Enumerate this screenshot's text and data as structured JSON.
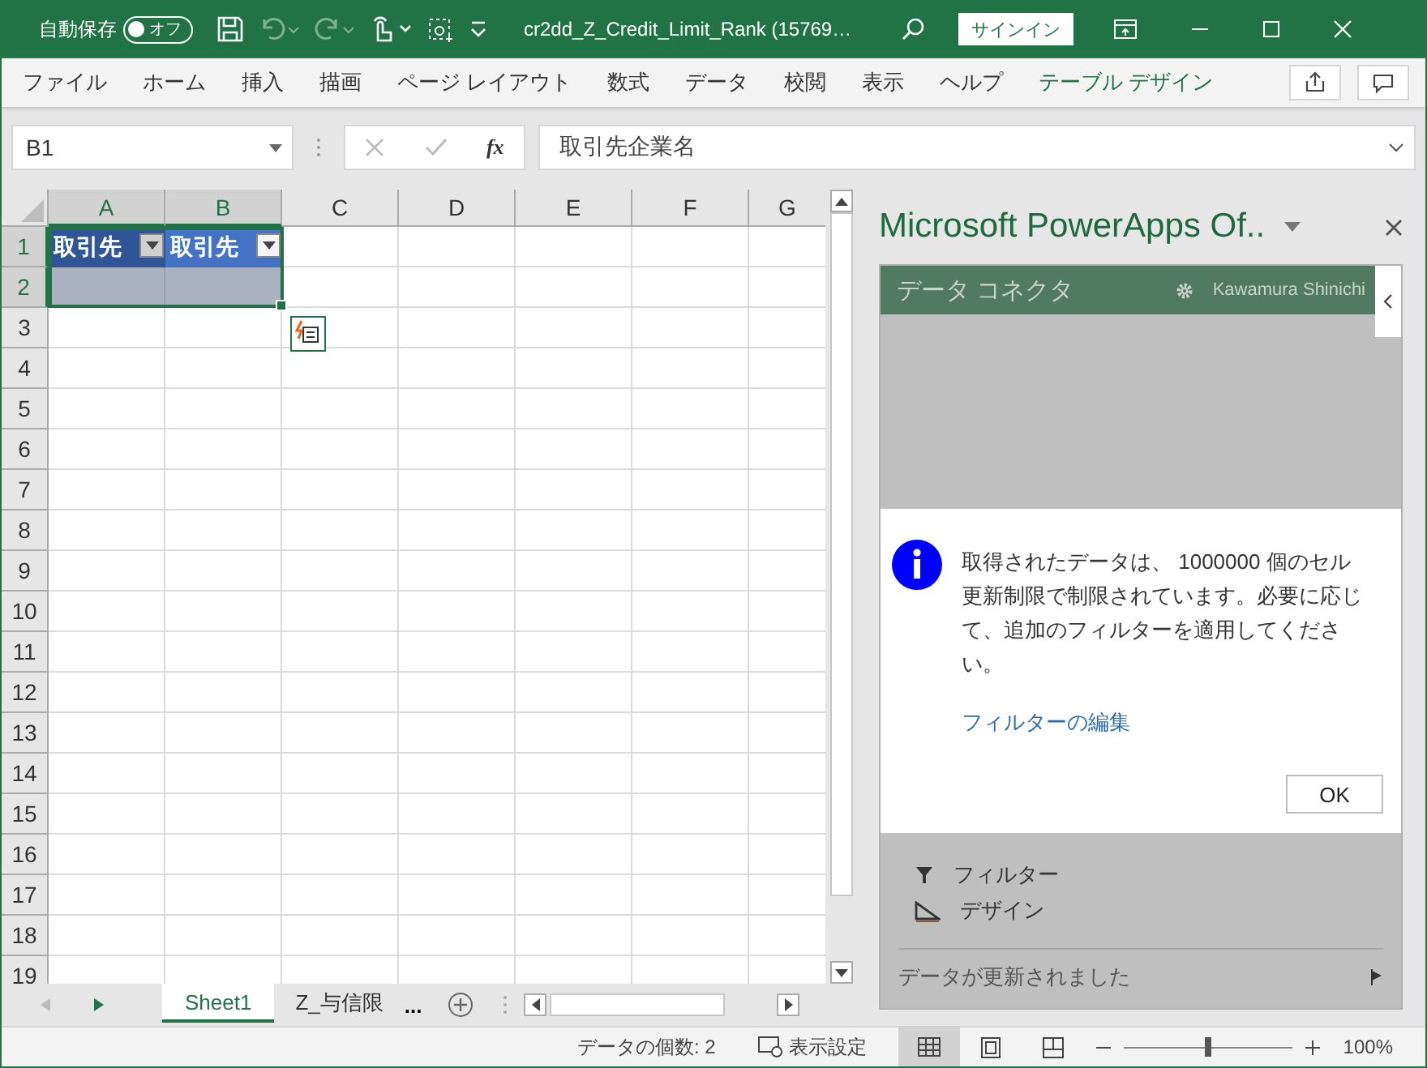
{
  "title_bar": {
    "autosave_label": "自動保存",
    "autosave_toggle": {
      "label": "オフ",
      "on": false
    },
    "filename": "cr2dd_Z_Credit_Limit_Rank (15769…",
    "signin": "サインイン"
  },
  "ribbon_tabs": [
    {
      "label": "ファイル",
      "contextual": false
    },
    {
      "label": "ホーム",
      "contextual": false
    },
    {
      "label": "挿入",
      "contextual": false
    },
    {
      "label": "描画",
      "contextual": false
    },
    {
      "label": "ページ レイアウト",
      "contextual": false
    },
    {
      "label": "数式",
      "contextual": false
    },
    {
      "label": "データ",
      "contextual": false
    },
    {
      "label": "校閲",
      "contextual": false
    },
    {
      "label": "表示",
      "contextual": false
    },
    {
      "label": "ヘルプ",
      "contextual": false
    },
    {
      "label": "テーブル デザイン",
      "contextual": true
    }
  ],
  "formula_bar": {
    "name_box": "B1",
    "function_label": "fx",
    "value": "取引先企業名"
  },
  "sheet": {
    "columns": [
      {
        "label": "A",
        "selected": true
      },
      {
        "label": "B",
        "selected": true
      },
      {
        "label": "C",
        "selected": false
      },
      {
        "label": "D",
        "selected": false
      },
      {
        "label": "E",
        "selected": false
      },
      {
        "label": "F",
        "selected": false
      },
      {
        "label": "G",
        "selected": false
      }
    ],
    "rows": [
      {
        "label": "1",
        "selected": true
      },
      {
        "label": "2",
        "selected": true
      },
      {
        "label": "3",
        "selected": false
      },
      {
        "label": "4",
        "selected": false
      },
      {
        "label": "5",
        "selected": false
      },
      {
        "label": "6",
        "selected": false
      },
      {
        "label": "7",
        "selected": false
      },
      {
        "label": "8",
        "selected": false
      },
      {
        "label": "9",
        "selected": false
      },
      {
        "label": "10",
        "selected": false
      },
      {
        "label": "11",
        "selected": false
      },
      {
        "label": "12",
        "selected": false
      },
      {
        "label": "13",
        "selected": false
      },
      {
        "label": "14",
        "selected": false
      },
      {
        "label": "15",
        "selected": false
      },
      {
        "label": "16",
        "selected": false
      },
      {
        "label": "17",
        "selected": false
      },
      {
        "label": "18",
        "selected": false
      },
      {
        "label": "19",
        "selected": false
      }
    ],
    "table_headers": [
      {
        "text": "取引先",
        "active": false
      },
      {
        "text": "取引先",
        "active": true
      }
    ]
  },
  "sheet_tabs": [
    {
      "label": "Sheet1",
      "selected": true
    },
    {
      "label": "Z_与信限",
      "selected": false
    }
  ],
  "more_sheets": "...",
  "task_pane": {
    "title": "Microsoft PowerApps Of..",
    "header": "データ コネクタ",
    "user": "Kawamura Shinichi",
    "dialog": {
      "message": "取得されたデータは、 1000000 個のセル更新制限で制限されています。必要に応じて、追加のフィルターを適用してください。",
      "link": "フィルターの編集",
      "ok": "OK"
    },
    "items": [
      {
        "label": "フィルター",
        "kind": "filter"
      },
      {
        "label": "デザイン",
        "kind": "design"
      }
    ],
    "status": "データが更新されました"
  },
  "status_bar": {
    "count": "データの個数: 2",
    "display_settings": "表示設定",
    "views": [
      {
        "kind": "normal",
        "selected": true
      },
      {
        "kind": "page",
        "selected": false
      },
      {
        "kind": "break",
        "selected": false
      }
    ],
    "zoom": {
      "level": 0.5,
      "reading": "100%"
    }
  }
}
